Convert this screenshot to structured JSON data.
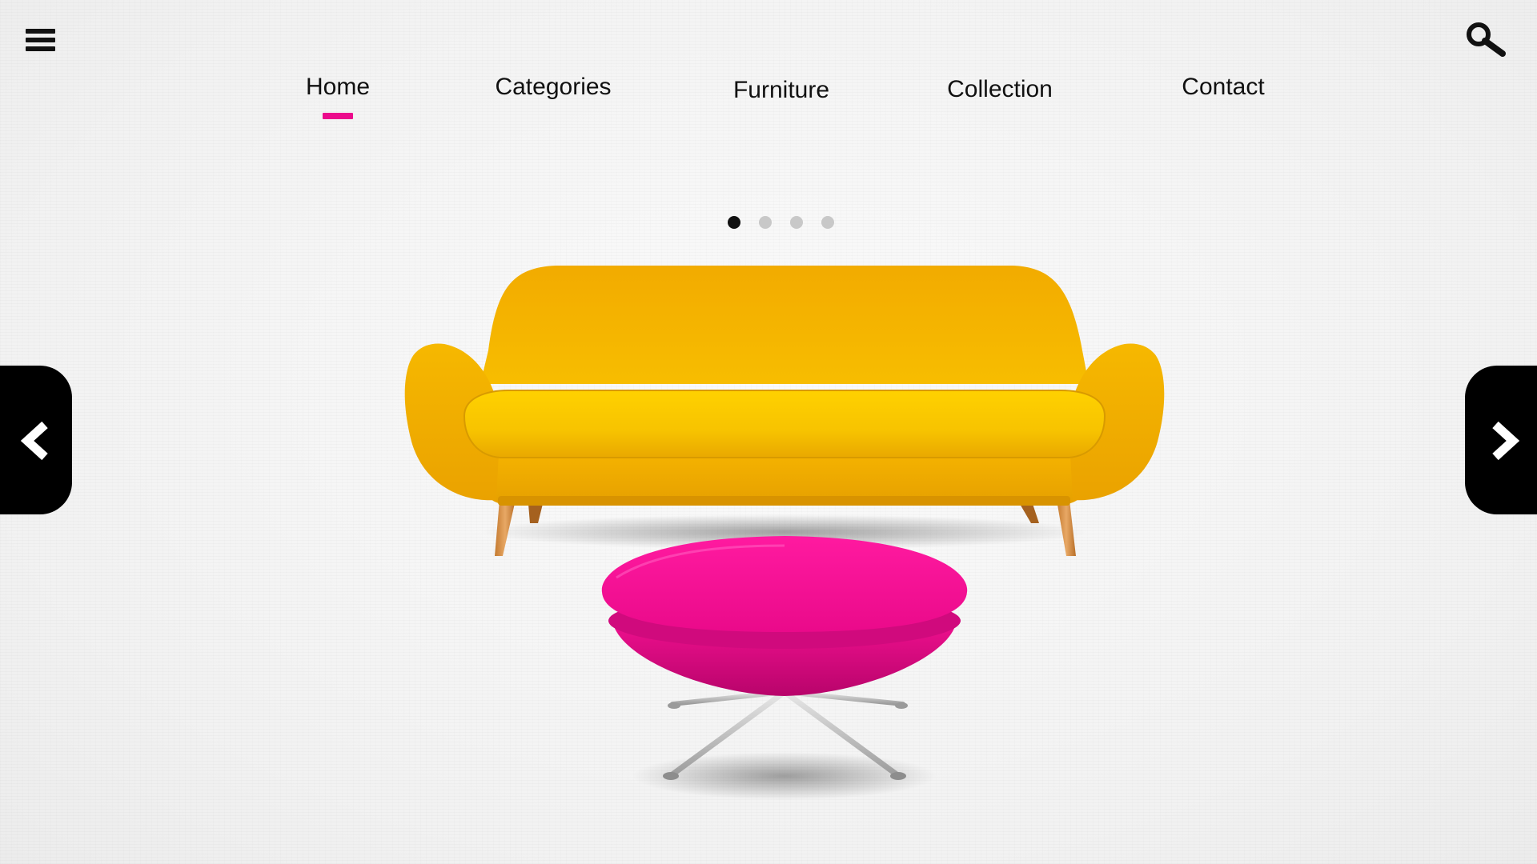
{
  "header": {
    "menu_icon": "hamburger-menu-icon",
    "search_icon": "magnifier-search-icon"
  },
  "nav": {
    "active_index": 0,
    "items": [
      {
        "label": "Home"
      },
      {
        "label": "Categories"
      },
      {
        "label": "Furniture"
      },
      {
        "label": "Collection"
      },
      {
        "label": "Contact"
      }
    ]
  },
  "carousel": {
    "slide_count": 4,
    "active_slide": 1,
    "prev_icon": "chevron-left-icon",
    "next_icon": "chevron-right-icon",
    "slide": {
      "products": [
        "sofa",
        "ottoman"
      ]
    }
  },
  "colors": {
    "accent": "#ec0a8c",
    "sofa": "#f5b000",
    "ottoman": "#ec0a8c",
    "button_bg": "#000000",
    "dot_inactive": "#c8c8c8",
    "dot_active": "#111111"
  }
}
